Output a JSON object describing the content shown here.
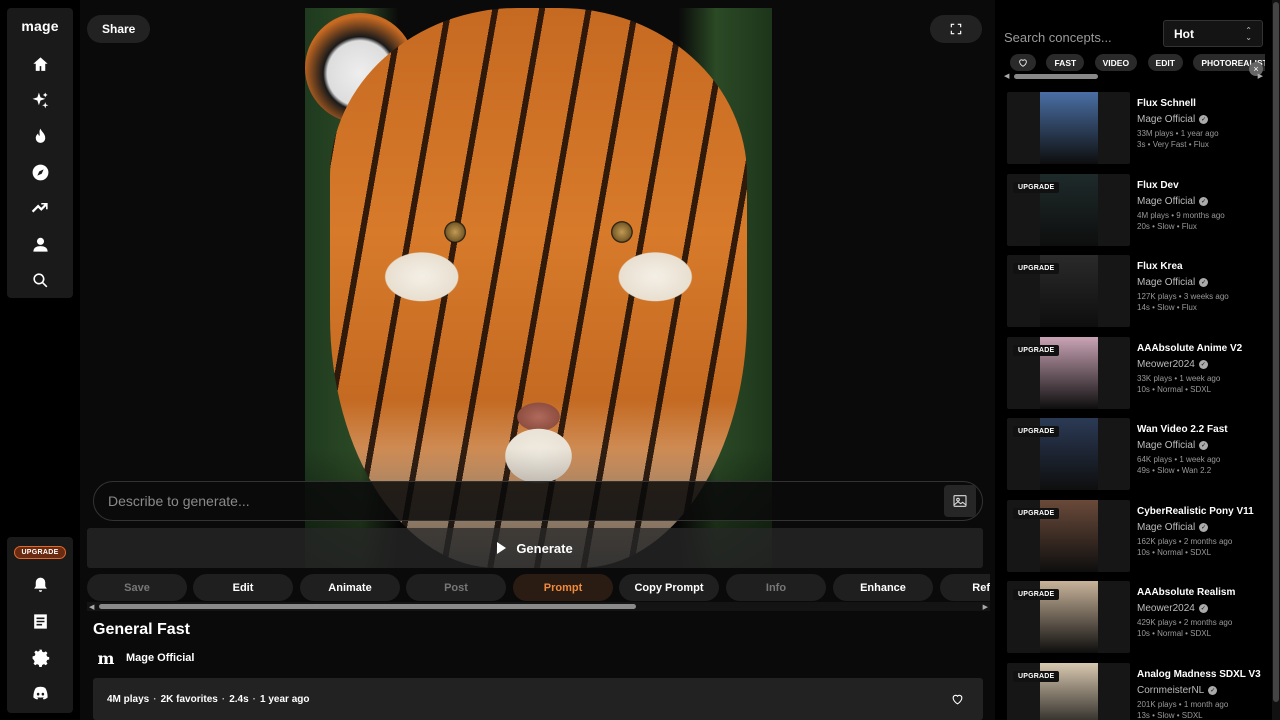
{
  "app": {
    "logo": "mage"
  },
  "sidebar": {
    "top_items": [
      {
        "name": "home-icon"
      },
      {
        "name": "sparkles-icon"
      },
      {
        "name": "flame-icon"
      },
      {
        "name": "compass-icon"
      },
      {
        "name": "trending-icon"
      },
      {
        "name": "user-icon"
      },
      {
        "name": "search-icon"
      }
    ],
    "upgrade_label": "UPGRADE",
    "bottom_items": [
      {
        "name": "bell-icon"
      },
      {
        "name": "document-icon"
      },
      {
        "name": "gear-icon"
      },
      {
        "name": "discord-icon"
      }
    ]
  },
  "main": {
    "share_label": "Share",
    "prompt_placeholder": "Describe to generate...",
    "generate_label": "Generate",
    "actions": [
      "Save",
      "Edit",
      "Animate",
      "Post",
      "Prompt",
      "Copy Prompt",
      "Info",
      "Enhance",
      "Ref"
    ],
    "model_title": "General Fast",
    "creator_logo": "m",
    "creator_name": "Mage Official",
    "stats": {
      "plays": "4M plays",
      "favorites": "2K favorites",
      "speed": "2.4s",
      "age": "1 year ago",
      "separator": "·"
    }
  },
  "right": {
    "search_placeholder": "Search concepts...",
    "sort_value": "Hot",
    "chips": [
      "FAST",
      "VIDEO",
      "EDIT",
      "PHOTOREALISTIC"
    ],
    "upgrade_tag": "UPGRADE",
    "models": [
      {
        "title": "Flux Schnell",
        "author": "Mage Official",
        "plays_age": "33M plays • 1 year ago",
        "meta": "3s • Very Fast • Flux",
        "upgrade": false,
        "color": "#4a6fa5"
      },
      {
        "title": "Flux Dev",
        "author": "Mage Official",
        "plays_age": "4M plays • 9 months ago",
        "meta": "20s • Slow • Flux",
        "upgrade": true,
        "color": "#1e2a2a"
      },
      {
        "title": "Flux Krea",
        "author": "Mage Official",
        "plays_age": "127K plays • 3 weeks ago",
        "meta": "14s • Slow • Flux",
        "upgrade": true,
        "color": "#2a2a2a"
      },
      {
        "title": "AAAbsolute Anime V2",
        "author": "Meower2024",
        "plays_age": "33K plays • 1 week ago",
        "meta": "10s • Normal • SDXL",
        "upgrade": true,
        "color": "#c9a3b4"
      },
      {
        "title": "Wan Video 2.2 Fast",
        "author": "Mage Official",
        "plays_age": "64K plays • 1 week ago",
        "meta": "49s • Slow • Wan 2.2",
        "upgrade": true,
        "color": "#2b3a55"
      },
      {
        "title": "CyberRealistic Pony V11",
        "author": "Mage Official",
        "plays_age": "162K plays • 2 months ago",
        "meta": "10s • Normal • SDXL",
        "upgrade": true,
        "color": "#6a4a3a"
      },
      {
        "title": "AAAbsolute Realism",
        "author": "Meower2024",
        "plays_age": "429K plays • 2 months ago",
        "meta": "10s • Normal • SDXL",
        "upgrade": true,
        "color": "#c8b39a"
      },
      {
        "title": "Analog Madness SDXL V3",
        "author": "CornmeisterNL",
        "plays_age": "201K plays • 1 month ago",
        "meta": "13s • Slow • SDXL",
        "upgrade": true,
        "color": "#d8c8b0"
      }
    ]
  }
}
